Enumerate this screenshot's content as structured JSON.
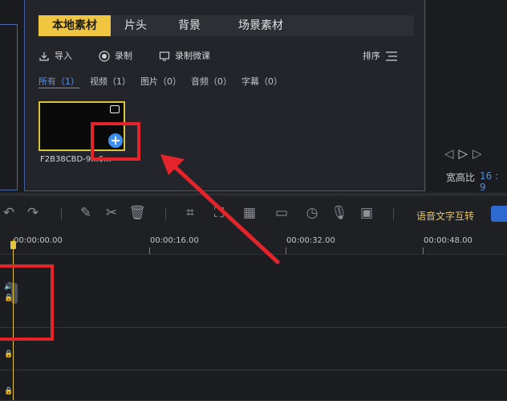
{
  "media": {
    "tabs": [
      "本地素材",
      "片头",
      "背景",
      "场景素材"
    ],
    "tools": {
      "import_label": "导入",
      "record_label": "录制",
      "micro_label": "录制微课",
      "sort_label": "排序"
    },
    "filters": [
      "所有（1）",
      "视频（1）",
      "图片（0）",
      "音频（0）",
      "字幕（0）"
    ],
    "clip": {
      "name": "F2B38CBD-9...6..."
    }
  },
  "preview": {
    "ratio_label": "宽高比",
    "ratio_value": "16 : 9"
  },
  "toolbar": {
    "voice_to_text_label": "语音文字互转"
  },
  "ruler": {
    "labels": [
      "00:00:00.00",
      "00:00:16.00",
      "00:00:32.00",
      "00:00:48.00"
    ]
  },
  "colors": {
    "accent_yellow": "#f0c640",
    "highlight_red": "#e3242b",
    "accent_blue": "#3b8ff0"
  }
}
